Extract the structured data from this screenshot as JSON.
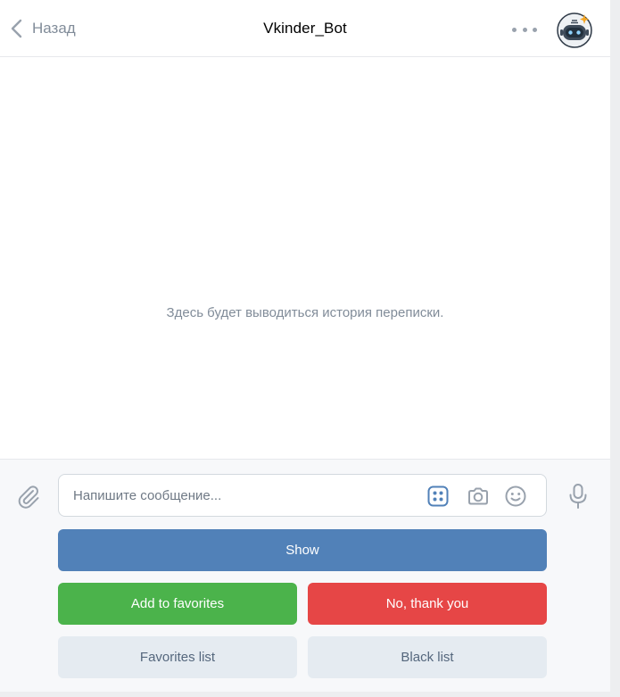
{
  "header": {
    "back_label": "Назад",
    "title": "Vkinder_Bot"
  },
  "history": {
    "empty_text": "Здесь будет выводиться история переписки."
  },
  "composer": {
    "placeholder": "Напишите сообщение...",
    "value": ""
  },
  "keyboard": {
    "show": "Show",
    "add_favorites": "Add to favorites",
    "no_thanks": "No, thank you",
    "favorites_list": "Favorites list",
    "black_list": "Black list"
  },
  "colors": {
    "primary": "#5181b8",
    "positive": "#4bb34b",
    "negative": "#e64646",
    "secondary": "#e5ebf1",
    "icon": "#99a2ad"
  },
  "icons": [
    "chevron-left-icon",
    "more-icon",
    "bot-avatar-icon",
    "paperclip-icon",
    "bot-keyboard-icon",
    "camera-icon",
    "smile-icon",
    "microphone-icon"
  ]
}
